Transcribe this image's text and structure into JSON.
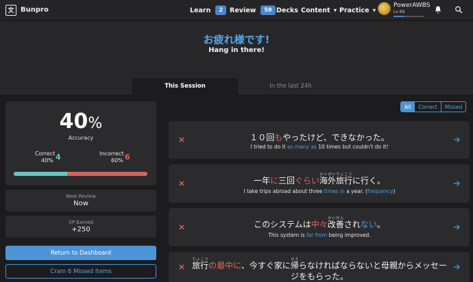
{
  "colors": {
    "accent": "#4d94d6",
    "correct": "#6ac4c4",
    "incorrect": "#d4665c",
    "background": "#1c1c1e"
  },
  "nav": {
    "logo": "Bunpro",
    "learn": {
      "label": "Learn",
      "count": "2"
    },
    "review": {
      "label": "Review",
      "count": "59"
    },
    "decks": "Decks",
    "content": "Content",
    "practice": "Practice",
    "user": {
      "name": "PowerAWBS",
      "level": "Lv 69",
      "xp_fraction": 0.35
    },
    "icons": [
      "bell-icon",
      "search-icon"
    ]
  },
  "header": {
    "jp_title": "お疲れ様です!",
    "subtitle": "Hang in there!",
    "tabs": {
      "this_session": "This Session",
      "last_24h": "In the last 24h"
    }
  },
  "summary": {
    "accuracy": "40",
    "accuracy_unit": "%",
    "accuracy_label": "Accuracy",
    "correct_label": "Correct",
    "correct_pct": "40%",
    "correct_count": "4",
    "incorrect_label": "Incorrect",
    "incorrect_pct": "60%",
    "incorrect_count": "6",
    "correct_fraction": 0.4,
    "next_review_label": "Next Review",
    "next_review_value": "Now",
    "xp_label": "XP Earned",
    "xp_value": "+250",
    "return_button": "Return to Dashboard",
    "cram_button": "Cram 6 Missed Items"
  },
  "filter": {
    "all": "All",
    "correct": "Correct",
    "missed": "Missed",
    "selected": "All"
  },
  "items": [
    {
      "jp": {
        "a": "１０回",
        "b": "も",
        "c": "やったけど、できなかった。"
      },
      "en": {
        "a": "I tried to do it ",
        "b": "as many as",
        "c": " 10 times but couldn't do it!"
      }
    },
    {
      "jp": {
        "a": "一年",
        "b": "に",
        "c": "三回",
        "d": "ぐらい",
        "e": "海外",
        "f": "旅行",
        "f_rt": "かいがいりょこう",
        "g": "に行く。"
      },
      "en": {
        "a": "I take trips abroad about three ",
        "b": "times in",
        "c": " a year. (",
        "d": "frequency",
        "e": ")"
      }
    },
    {
      "jp": {
        "a": "このシステムは",
        "b": "中々",
        "c": "改善",
        "c_rt": "かいぜん",
        "d": "され",
        "e": "ない",
        "f": "。"
      },
      "en": {
        "a": "This system is ",
        "b": "far from",
        "c": " being improved."
      }
    },
    {
      "jp": {
        "a": "旅行",
        "a_rt": "りょこう",
        "b": "の最中に",
        "c": "、今すぐ家に",
        "d": "帰",
        "d_rt": "かえ",
        "e": "らなければならないと母親からメッセージをもらった。"
      }
    }
  ]
}
